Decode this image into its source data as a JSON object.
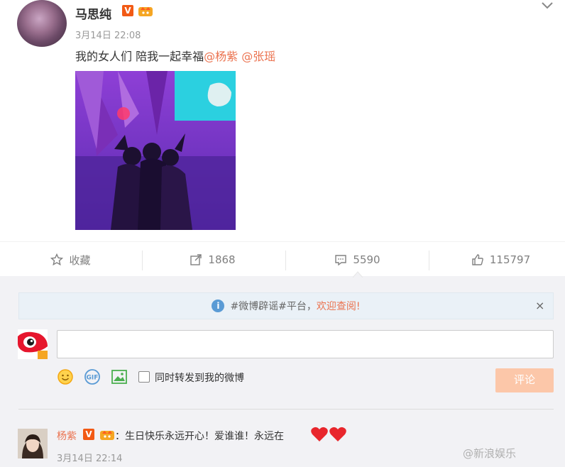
{
  "post": {
    "username": "马思纯",
    "v_badge": "V",
    "timestamp": "3月14日 22:08",
    "text": "我的女人们 陪我一起幸福",
    "mentions": [
      "@杨紫",
      "@张瑶"
    ]
  },
  "actions": {
    "favorite_label": "收藏",
    "repost_count": "1868",
    "comment_count": "5590",
    "like_count": "115797"
  },
  "rumor_bar": {
    "text": "#微博辟谣#平台，",
    "link": "欢迎查阅!",
    "close": "×"
  },
  "composer": {
    "repost_label": "同时转发到我的微博",
    "submit_label": "评论",
    "input_value": ""
  },
  "comment": {
    "username": "杨紫",
    "v_badge": "V",
    "text": "：生日快乐永远开心！爱谁谁！永远在",
    "timestamp": "3月14日 22:14"
  },
  "watermark": "@新浪娱乐",
  "colors": {
    "link_orange": "#eb7350",
    "v_badge": "#f25a15",
    "submit_disabled": "#fcc7a9",
    "panel_bg": "#f2f2f5"
  }
}
